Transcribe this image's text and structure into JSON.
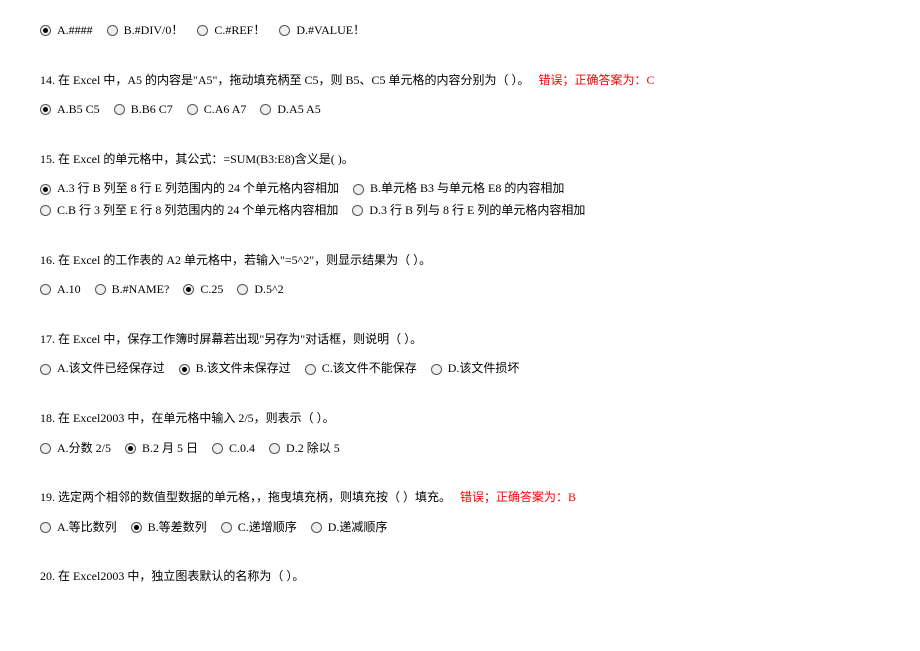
{
  "questions": [
    {
      "id": "q13",
      "text": "",
      "feedback": "",
      "options": [
        {
          "label": "A.####",
          "selected": true
        },
        {
          "label": "B.#DIV/0！",
          "selected": false
        },
        {
          "label": "C.#REF！",
          "selected": false
        },
        {
          "label": "D.#VALUE！",
          "selected": false
        }
      ]
    },
    {
      "id": "q14",
      "text": "14.  在 Excel 中，A5 的内容是\"A5\"，拖动填充柄至 C5，则 B5、C5 单元格的内容分别为（ ）。",
      "feedback": "错误；正确答案为：C",
      "options": [
        {
          "label": "A.B5 C5",
          "selected": true
        },
        {
          "label": "B.B6 C7",
          "selected": false
        },
        {
          "label": "C.A6 A7",
          "selected": false
        },
        {
          "label": "D.A5 A5",
          "selected": false
        }
      ]
    },
    {
      "id": "q15",
      "text": "15.  在 Excel 的单元格中，其公式：=SUM(B3:E8)含义是( )。",
      "feedback": "",
      "options": [
        {
          "label": "A.3 行 B 列至 8 行 E 列范围内的 24 个单元格内容相加",
          "selected": true
        },
        {
          "label": "B.单元格 B3 与单元格 E8 的内容相加",
          "selected": false
        },
        {
          "label": "C.B 行 3 列至 E 行 8 列范围内的 24 个单元格内容相加",
          "selected": false
        },
        {
          "label": "D.3 行 B 列与 8 行 E 列的单元格内容相加",
          "selected": false
        }
      ]
    },
    {
      "id": "q16",
      "text": "16.  在 Excel 的工作表的 A2 单元格中，若输入\"=5^2\"，则显示结果为（  ）。",
      "feedback": "",
      "options": [
        {
          "label": "A.10",
          "selected": false
        },
        {
          "label": "B.#NAME?",
          "selected": false
        },
        {
          "label": "C.25",
          "selected": true
        },
        {
          "label": "D.5^2",
          "selected": false
        }
      ]
    },
    {
      "id": "q17",
      "text": "17.  在 Excel 中，保存工作簿时屏幕若出现\"另存为\"对话框，则说明（  ）。",
      "feedback": "",
      "options": [
        {
          "label": "A.该文件已经保存过",
          "selected": false
        },
        {
          "label": "B.该文件未保存过",
          "selected": true
        },
        {
          "label": "C.该文件不能保存",
          "selected": false
        },
        {
          "label": "D.该文件损坏",
          "selected": false
        }
      ]
    },
    {
      "id": "q18",
      "text": "18.  在 Excel2003 中，在单元格中输入 2/5，则表示（  ）。",
      "feedback": "",
      "options": [
        {
          "label": "A.分数 2/5",
          "selected": false
        },
        {
          "label": "B.2 月 5 日",
          "selected": true
        },
        {
          "label": "C.0.4",
          "selected": false
        },
        {
          "label": "D.2 除以 5",
          "selected": false
        }
      ]
    },
    {
      "id": "q19",
      "text": "19.  选定两个相邻的数值型数据的单元格，，拖曳填充柄，则填充按（ ）填充。",
      "feedback": "错误；正确答案为：B",
      "options": [
        {
          "label": "A.等比数列",
          "selected": false
        },
        {
          "label": "B.等差数列",
          "selected": true
        },
        {
          "label": "C.递增顺序",
          "selected": false
        },
        {
          "label": "D.递减顺序",
          "selected": false
        }
      ]
    },
    {
      "id": "q20",
      "text": "20.  在 Excel2003 中，独立图表默认的名称为（  ）。",
      "feedback": "",
      "options": []
    }
  ]
}
